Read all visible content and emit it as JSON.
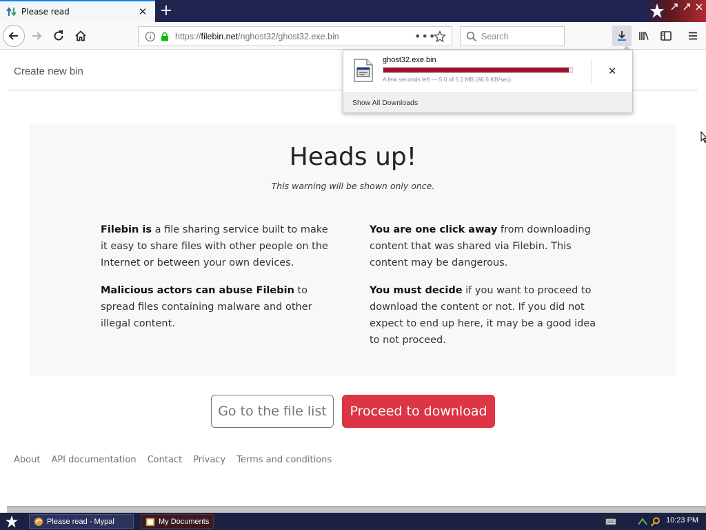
{
  "browser": {
    "tab": {
      "title": "Please read"
    },
    "url": {
      "protocol": "https://",
      "host": "filebin.net",
      "path": "/nghost32/ghost32.exe.bin"
    },
    "search": {
      "placeholder": "Search"
    }
  },
  "downloads": {
    "file_name": "ghost32.exe.bin",
    "status": "A few seconds left — 5.0 of 5.1 MB (86.6 KB/sec)",
    "progress": 0.98,
    "show_all_label": "Show All Downloads",
    "progress_color": "#a0102a"
  },
  "page": {
    "create_bin": "Create new bin",
    "title": "Heads up!",
    "subtitle": "This warning will be shown only once.",
    "left_col": {
      "p1_strong": "Filebin is",
      "p1_text": " a file sharing service built to make it easy to share files with other people on the Internet or between your own devices.",
      "p2_strong": "Malicious actors can abuse Filebin",
      "p2_text": " to spread files containing malware and other illegal content."
    },
    "right_col": {
      "p1_strong": "You are one click away",
      "p1_text": " from downloading content that was shared via Filebin. This content may be dangerous.",
      "p2_strong": "You must decide",
      "p2_text": " if you want to proceed to download the content or not. If you did not expect to end up here, it may be a good idea to not proceed."
    },
    "buttons": {
      "file_list": "Go to the file list",
      "proceed": "Proceed to download"
    },
    "footer": [
      "About",
      "API documentation",
      "Contact",
      "Privacy",
      "Terms and conditions"
    ],
    "colors": {
      "proceed": "#dc3545",
      "secondary": "#6c757d"
    }
  },
  "taskbar": {
    "items": [
      "Please read - Mypal",
      "My Documents"
    ],
    "clock": "10:23 PM"
  }
}
